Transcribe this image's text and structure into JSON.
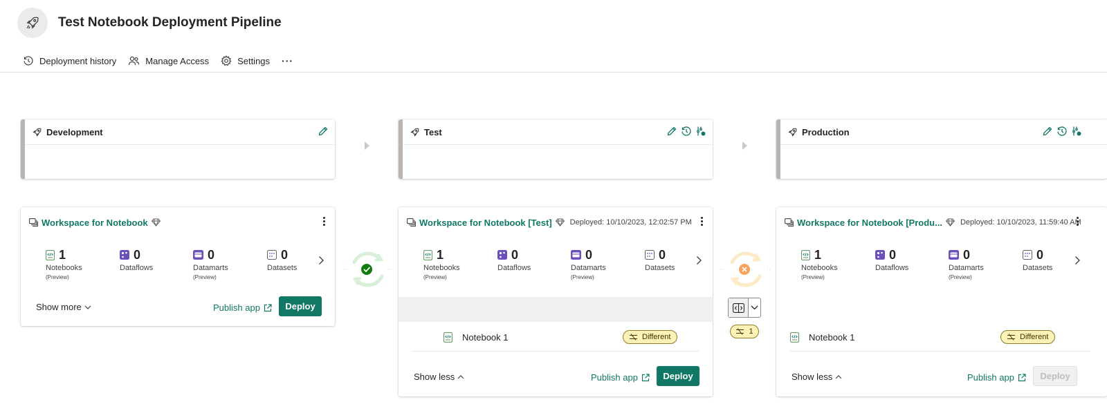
{
  "header": {
    "title": "Test Notebook Deployment Pipeline",
    "logo_icon": "rocket-icon"
  },
  "toolbar": {
    "history_label": "Deployment history",
    "access_label": "Manage Access",
    "settings_label": "Settings",
    "more_label": "···"
  },
  "colors": {
    "accent": "#117865",
    "stage_bar": "#bab5b0",
    "success": "#107c10",
    "warning": "#f7a35c",
    "diff_badge_bg": "#fbf2b8"
  },
  "stages": [
    {
      "name": "Development",
      "icons": [
        "edit-icon"
      ]
    },
    {
      "name": "Test",
      "icons": [
        "edit-icon",
        "history-icon",
        "stage-settings-icon"
      ]
    },
    {
      "name": "Production",
      "icons": [
        "edit-icon",
        "history-icon",
        "stage-settings-icon"
      ]
    }
  ],
  "workspaces": [
    {
      "name": "Workspace for Notebook",
      "deployed": "",
      "counts": [
        {
          "label": "Notebooks",
          "sub": "(Preview)",
          "value": "1",
          "icon": "notebook-icon"
        },
        {
          "label": "Dataflows",
          "sub": "",
          "value": "0",
          "icon": "dataflow-icon"
        },
        {
          "label": "Datamarts",
          "sub": "(Preview)",
          "value": "0",
          "icon": "datamart-icon"
        },
        {
          "label": "Datasets",
          "sub": "",
          "value": "0",
          "icon": "dataset-icon"
        }
      ],
      "show_label": "Show more",
      "publish_label": "Publish app",
      "deploy_label": "Deploy"
    },
    {
      "name": "Workspace for Notebook [Test]",
      "deployed": "Deployed: 10/10/2023, 12:02:57 PM",
      "counts": [
        {
          "label": "Notebooks",
          "sub": "(Preview)",
          "value": "1",
          "icon": "notebook-icon"
        },
        {
          "label": "Dataflows",
          "sub": "",
          "value": "0",
          "icon": "dataflow-icon"
        },
        {
          "label": "Datamarts",
          "sub": "(Preview)",
          "value": "0",
          "icon": "datamart-icon"
        },
        {
          "label": "Datasets",
          "sub": "",
          "value": "0",
          "icon": "dataset-icon"
        }
      ],
      "items": [
        {
          "name": "Notebook 1",
          "status": "Different"
        }
      ],
      "show_label": "Show less",
      "publish_label": "Publish app",
      "deploy_label": "Deploy"
    },
    {
      "name": "Workspace for Notebook [Produ...",
      "deployed": "Deployed: 10/10/2023, 11:59:40 AM",
      "counts": [
        {
          "label": "Notebooks",
          "sub": "(Preview)",
          "value": "1",
          "icon": "notebook-icon"
        },
        {
          "label": "Dataflows",
          "sub": "",
          "value": "0",
          "icon": "dataflow-icon"
        },
        {
          "label": "Datamarts",
          "sub": "(Preview)",
          "value": "0",
          "icon": "datamart-icon"
        },
        {
          "label": "Datasets",
          "sub": "",
          "value": "0",
          "icon": "dataset-icon"
        }
      ],
      "items": [
        {
          "name": "Notebook 1",
          "status": "Different"
        }
      ],
      "show_label": "Show less",
      "publish_label": "Publish app",
      "deploy_label": "Deploy",
      "deploy_disabled": true
    }
  ],
  "connectors": [
    {
      "status": "in-sync",
      "icon": "sync-success-icon"
    },
    {
      "status": "different",
      "icon": "sync-warning-icon",
      "diff_count": "1"
    }
  ]
}
